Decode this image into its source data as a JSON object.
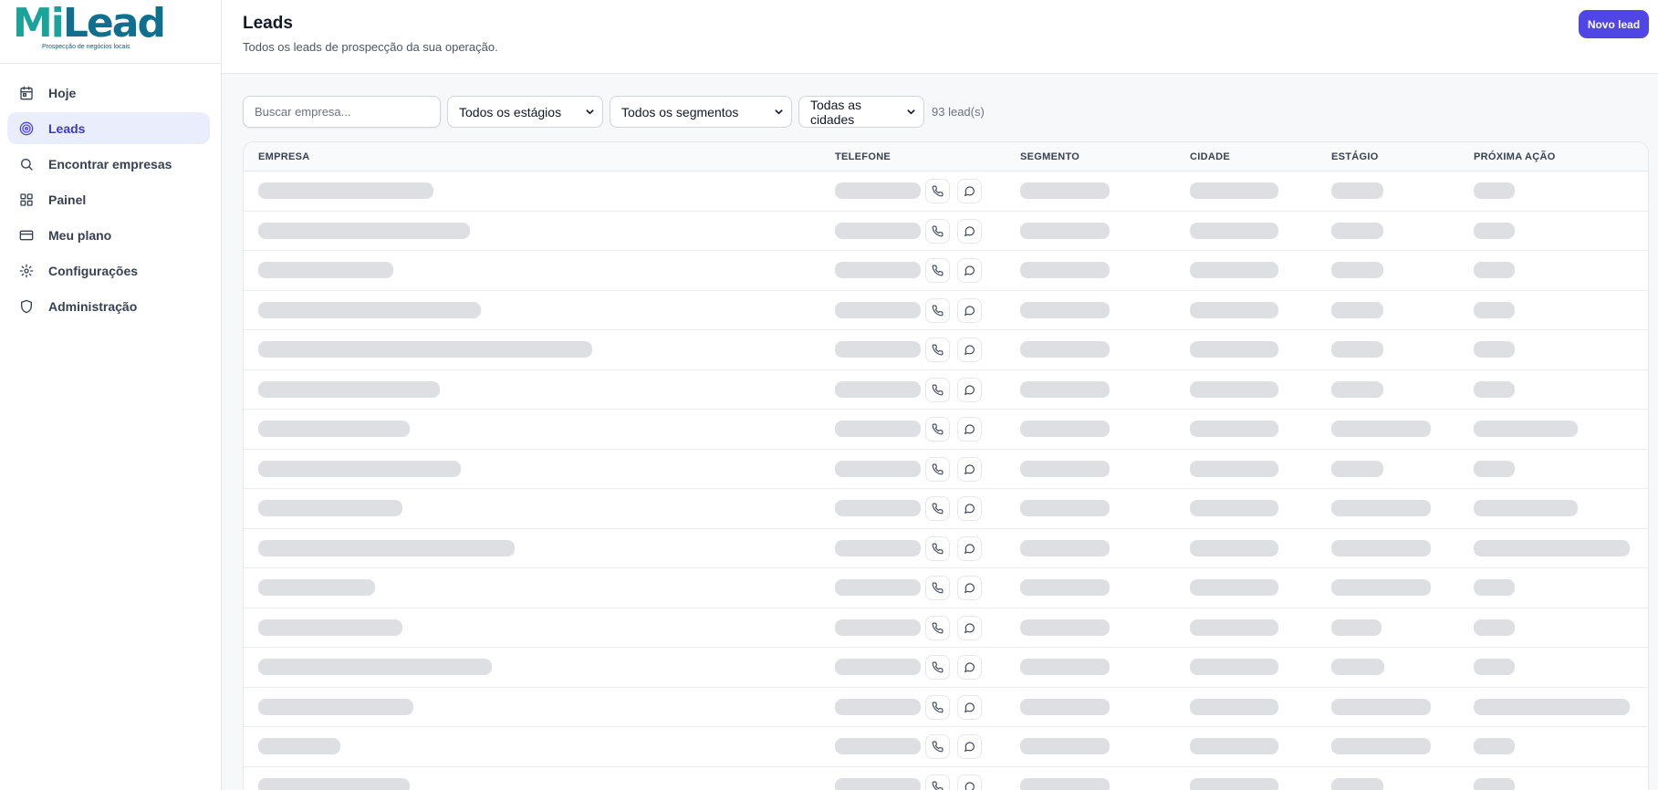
{
  "brand": {
    "logo_part1": "Mi",
    "logo_part2": "Lead",
    "tagline": "Prospecção de negócios locais"
  },
  "colors": {
    "accent": "#4f46e5",
    "active_bg": "#e9edfc",
    "logo_teal": "#1aa39a",
    "logo_blue": "#0f6f8f",
    "skeleton": "#dedfe3"
  },
  "sidebar": {
    "items": [
      {
        "label": "Hoje",
        "icon": "calendar-icon"
      },
      {
        "label": "Leads",
        "icon": "target-icon",
        "active": true
      },
      {
        "label": "Encontrar empresas",
        "icon": "search-icon"
      },
      {
        "label": "Painel",
        "icon": "grid-icon"
      },
      {
        "label": "Meu plano",
        "icon": "credit-card-icon"
      },
      {
        "label": "Configurações",
        "icon": "gear-icon"
      },
      {
        "label": "Administração",
        "icon": "shield-icon"
      }
    ]
  },
  "header": {
    "title": "Leads",
    "subtitle": "Todos os leads de prospecção da sua operação.",
    "new_lead_label": "Novo lead"
  },
  "filters": {
    "search_placeholder": "Buscar empresa...",
    "stage_select": "Todos os estágios",
    "segment_select": "Todos os segmentos",
    "city_select": "Todas as cidades",
    "count_text": "93 lead(s)"
  },
  "table": {
    "columns": [
      "EMPRESA",
      "TELEFONE",
      "SEGMENTO",
      "CIDADE",
      "ESTÁGIO",
      "PRÓXIMA AÇÃO"
    ],
    "loading_rows": 16
  }
}
